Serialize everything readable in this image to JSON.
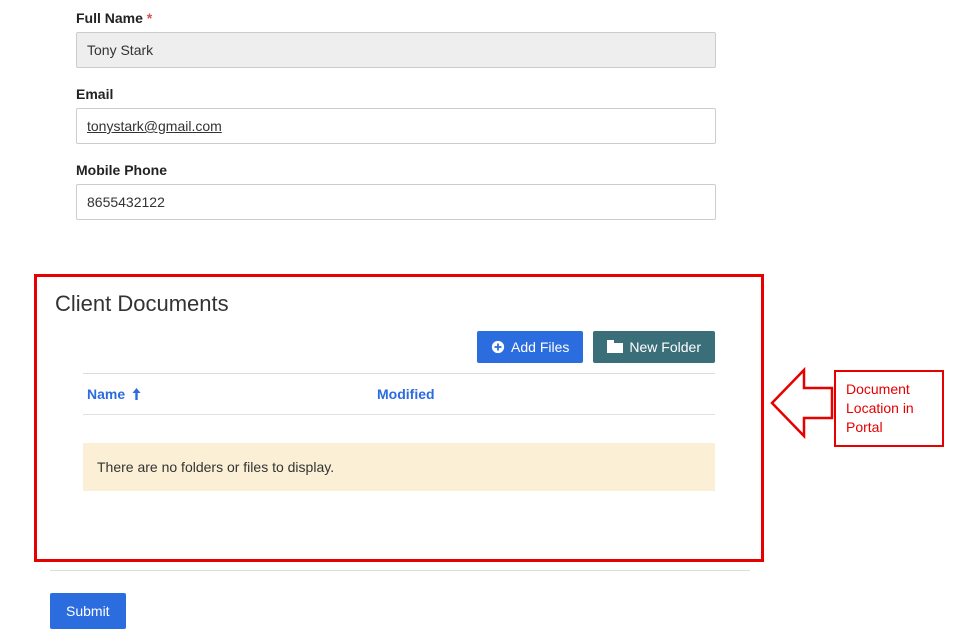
{
  "form": {
    "full_name": {
      "label": "Full Name",
      "required_marker": "*",
      "value": "Tony Stark"
    },
    "email": {
      "label": "Email",
      "value": "tonystark@gmail.com"
    },
    "mobile": {
      "label": "Mobile Phone",
      "value": "8655432122"
    },
    "submit_label": "Submit"
  },
  "documents": {
    "section_title": "Client Documents",
    "add_files_label": "Add Files",
    "new_folder_label": "New Folder",
    "columns": {
      "name": "Name",
      "modified": "Modified"
    },
    "empty_message": "There are no folders or files to display."
  },
  "annotation": {
    "callout_text": "Document Location in Portal"
  },
  "colors": {
    "accent_blue": "#2b6cdf",
    "accent_teal": "#3a6f7a",
    "highlight_red": "#e60000",
    "warn_bg": "#fbf0d6"
  }
}
